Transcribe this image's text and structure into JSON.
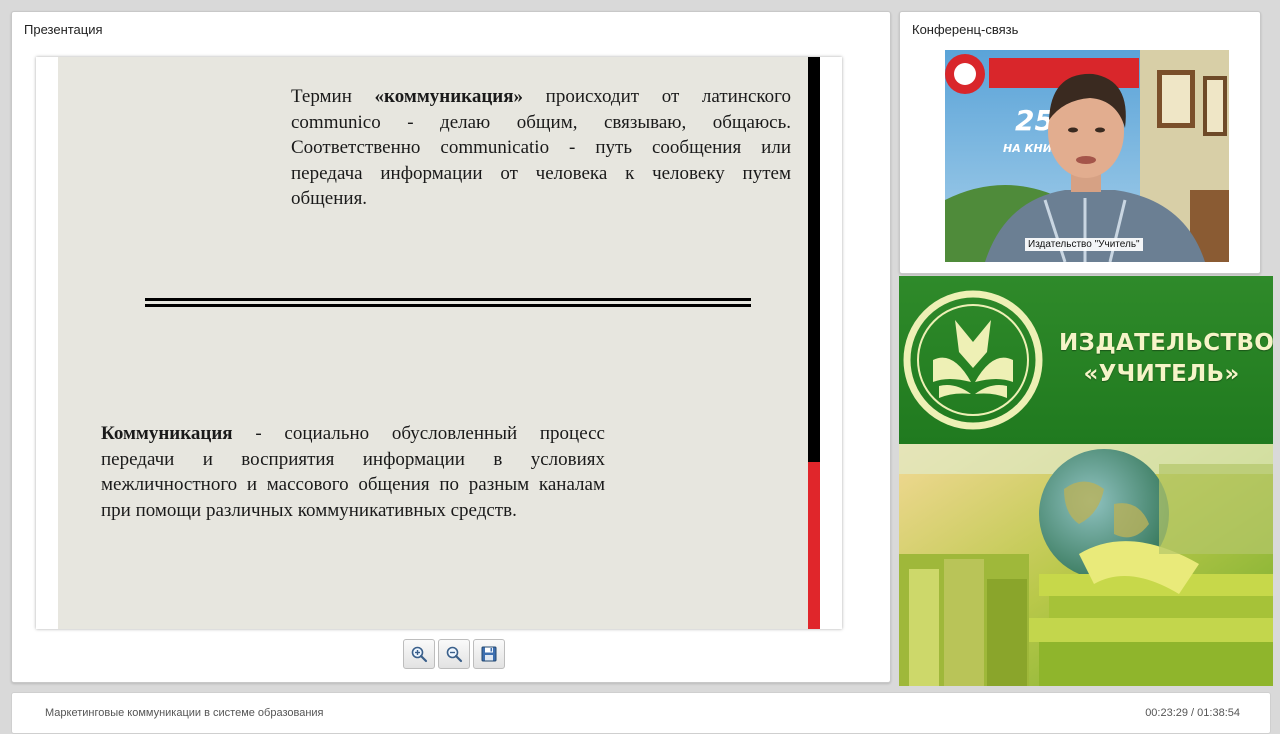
{
  "presentation": {
    "panel_title": "Презентация",
    "slide": {
      "term_prefix": "Термин ",
      "term_bold": "«коммуникация»",
      "term_rest": " происходит от латинского communico - делаю общим, связываю, общаюсь. Соответственно communicatio - путь сообщения или передача информации от человека к человеку путем общения.",
      "def_bold": "Коммуникация",
      "def_rest": " - социально обусловленный процесс передачи и восприятия информации в условиях межличностного и массового общения по разным каналам при помощи различных коммуникативных средств."
    },
    "toolbar": {
      "zoom_in_icon": "zoom-in-icon",
      "zoom_out_icon": "zoom-out-icon",
      "save_icon": "save-icon"
    }
  },
  "conference": {
    "panel_title": "Конференц-связь",
    "video_label": "Издательство \"Учитель\"",
    "banner_text": "25 ЛЕТ НА КНИЖНОМ РОС"
  },
  "branding": {
    "line1": "ИЗДАТЕЛЬСТВО",
    "line2": "«УЧИТЕЛЬ»"
  },
  "footer": {
    "title": "Маркетинговые коммуникации в системе образования",
    "time": "00:23:29 / 01:38:54"
  },
  "colors": {
    "slide_bg": "#e7e6df",
    "bar_black": "#000000",
    "bar_red": "#e0262b",
    "brand_green": "#2f8a2a",
    "brand_text": "#f6f4c8"
  }
}
